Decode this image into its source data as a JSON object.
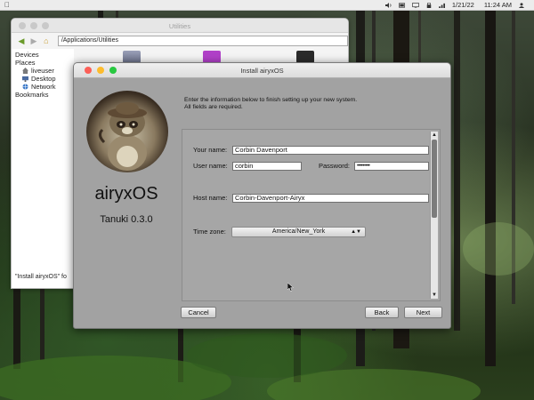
{
  "menubar": {
    "date": "1/21/22",
    "time": "11:24 AM",
    "icons": [
      "apple-icon",
      "volume-icon",
      "battery-icon",
      "display-icon",
      "lock-icon",
      "network-icon",
      "person-icon"
    ]
  },
  "file_manager": {
    "title": "Utilities",
    "path": "/Applications/Utilities",
    "sidebar": {
      "devices_label": "Devices",
      "places_label": "Places",
      "places": [
        {
          "label": "liveuser",
          "icon": "home-icon"
        },
        {
          "label": "Desktop",
          "icon": "desktop-icon"
        },
        {
          "label": "Network",
          "icon": "network-icon"
        }
      ],
      "bookmarks_label": "Bookmarks"
    },
    "status": "\"Install airyxOS\" fo"
  },
  "installer": {
    "title": "Install airyxOS",
    "brand_name": "airyxOS",
    "version": "Tanuki 0.3.0",
    "intro_line1": "Enter the information below to finish setting up your new system.",
    "intro_line2": "All fields are required.",
    "fields": {
      "your_name_label": "Your name:",
      "your_name_value": "Corbin  Davenport",
      "user_name_label": "User name:",
      "user_name_value": "corbin",
      "password_label": "Password:",
      "password_value": "•••••••••",
      "host_name_label": "Host name:",
      "host_name_value": "Corbin-Davenport-Airyx",
      "time_zone_label": "Time zone:",
      "time_zone_value": "America/New_York"
    },
    "buttons": {
      "cancel": "Cancel",
      "back": "Back",
      "next": "Next"
    },
    "colors": {
      "close": "#fc5f57",
      "minimize": "#fdbc2e",
      "maximize": "#28c840"
    }
  }
}
